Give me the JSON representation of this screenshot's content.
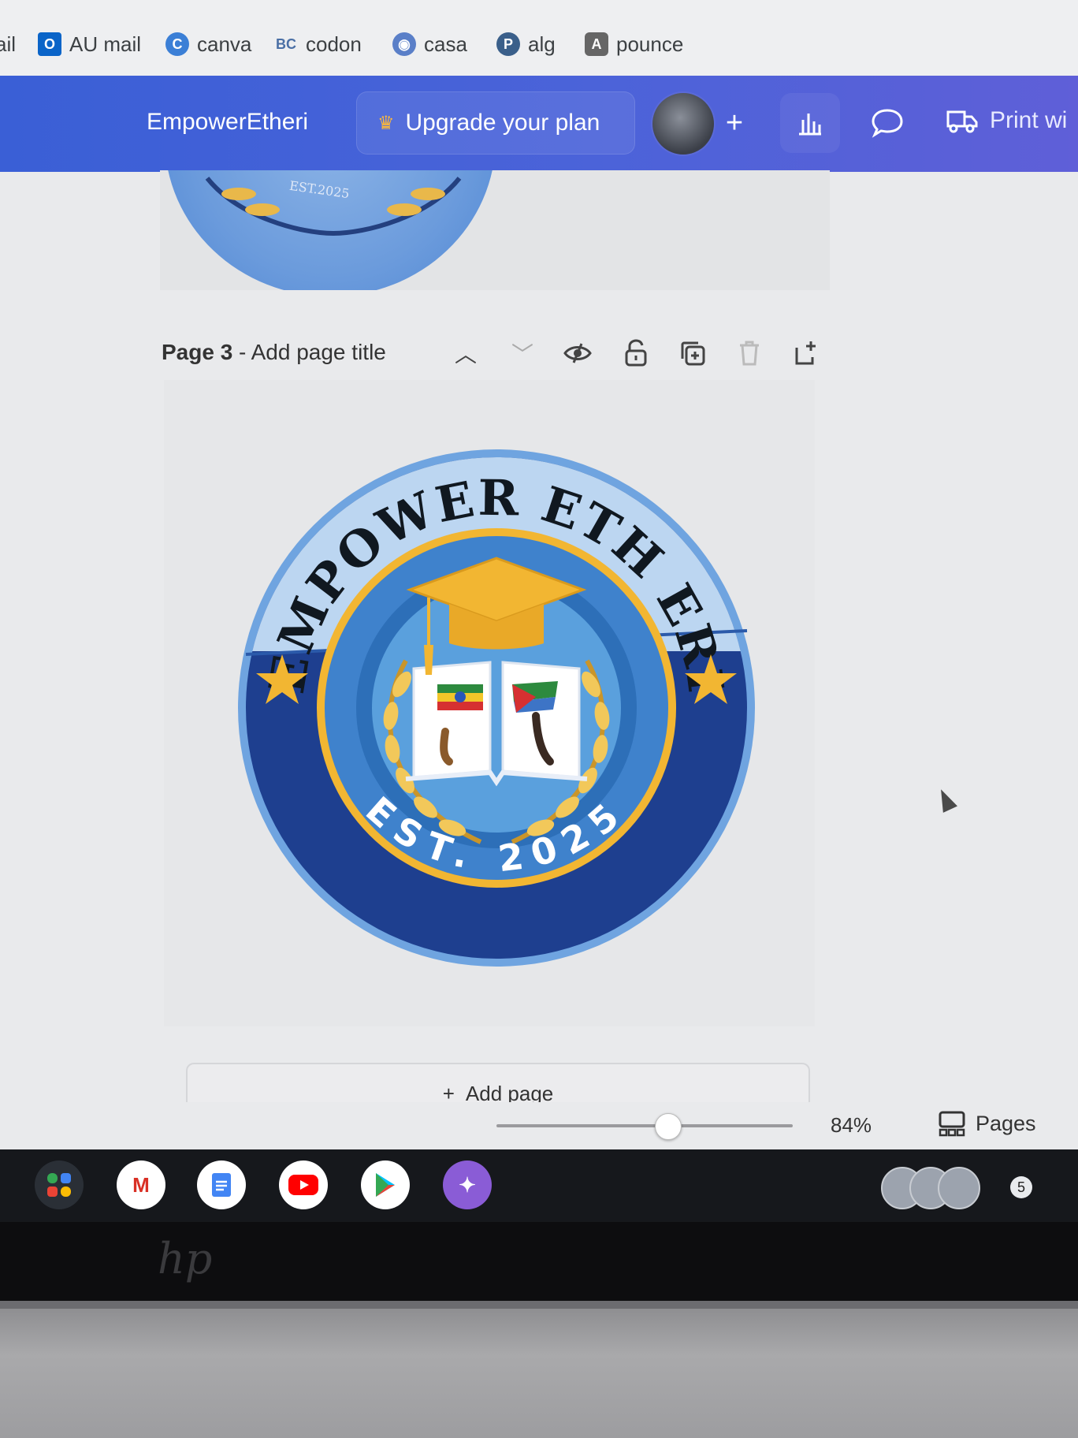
{
  "bookmarks": [
    {
      "label": "ail",
      "icon": "partial-icon"
    },
    {
      "label": "AU mail",
      "icon": "outlook-icon"
    },
    {
      "label": "canva",
      "icon": "canva-icon"
    },
    {
      "label": "codon",
      "icon": "codon-icon"
    },
    {
      "label": "casa",
      "icon": "casa-icon"
    },
    {
      "label": "alg",
      "icon": "alg-icon"
    },
    {
      "label": "pounce",
      "icon": "pounce-icon"
    }
  ],
  "header": {
    "doc_name": "EmpowerEtheri",
    "upgrade_label": "Upgrade your plan",
    "print_label": "Print wi"
  },
  "page": {
    "title_num": "Page 3",
    "title_rest": " - Add page title",
    "add_page_label": "Add page"
  },
  "logo": {
    "top_text": "EMPOWER ETH ERI",
    "bottom_text": "EST. 2025",
    "prev_est": "EST.2025"
  },
  "footer": {
    "zoom": "84%",
    "pages_label": "Pages",
    "zoom_fraction": 0.58
  },
  "tray": {
    "notification_count": "5"
  },
  "colors": {
    "header": "#4b63d9",
    "navy": "#1e3f8f",
    "gold": "#f2b632",
    "light_blue": "#bcd6f1"
  }
}
